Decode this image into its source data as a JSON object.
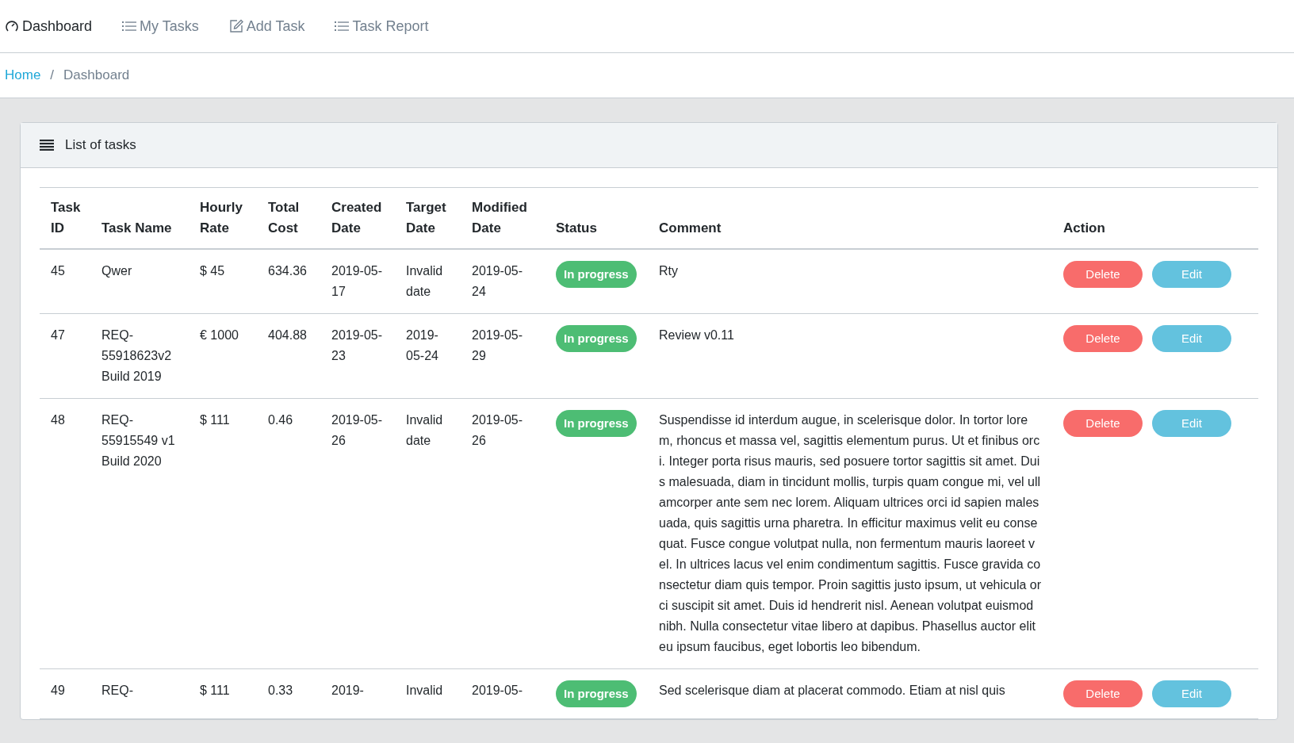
{
  "nav": [
    {
      "kind": "gauge",
      "label": "Dashboard",
      "selected": true
    },
    {
      "kind": "list",
      "label": "My Tasks",
      "selected": false
    },
    {
      "kind": "edit",
      "label": "Add Task",
      "selected": false
    },
    {
      "kind": "list",
      "label": "Task Report",
      "selected": false
    }
  ],
  "breadcrumb": [
    {
      "label": "Home",
      "kind": "link"
    },
    {
      "kind": "separator",
      "label": "/"
    },
    {
      "label": "Dashboard",
      "kind": "current"
    }
  ],
  "card": {
    "title": "List of tasks"
  },
  "table": {
    "columns": [
      "Task ID",
      "Task Name",
      "Hourly Rate",
      "Total Cost",
      "Created Date",
      "Target Date",
      "Modified Date",
      "Status",
      "Comment",
      "Action"
    ],
    "rows": [
      {
        "id": "45",
        "name": "Qwer",
        "rate": "$ 45",
        "cost": "634.36",
        "created": "2019-05-17",
        "target": "Invalid date",
        "modified": "2019-05-24",
        "status": {
          "label": "In progress",
          "kind": "progress"
        },
        "comment": "Rty",
        "actions": [
          {
            "label": "Delete",
            "kind": "danger"
          },
          {
            "label": "Edit",
            "kind": "info"
          }
        ]
      },
      {
        "id": "47",
        "name": "REQ-55918623v2 Build 2019",
        "rate": "€ 1000",
        "cost": "404.88",
        "created": "2019-05-23",
        "target": "2019-05-24",
        "modified": "2019-05-29",
        "status": {
          "label": "In progress",
          "kind": "progress"
        },
        "comment": "Review v0.11",
        "actions": [
          {
            "label": "Delete",
            "kind": "danger"
          },
          {
            "label": "Edit",
            "kind": "info"
          }
        ]
      },
      {
        "id": "48",
        "name": "REQ-55915549 v1 Build 2020",
        "rate": "$ 111",
        "cost": "0.46",
        "created": "2019-05-26",
        "target": "Invalid date",
        "modified": "2019-05-26",
        "status": {
          "label": "In progress",
          "kind": "progress"
        },
        "comment": "Suspendisse id interdum augue, in scelerisque dolor. In tortor lorem, rhoncus et massa vel, sagittis elementum purus. Ut et finibus orci. Integer porta risus mauris, sed posuere tortor sagittis sit amet. Duis malesuada, diam in tincidunt mollis, turpis quam congue mi, vel ullamcorper ante sem nec lorem. Aliquam ultrices orci id sapien malesuada, quis sagittis urna pharetra. In efficitur maximus velit eu consequat. Fusce congue volutpat nulla, non fermentum mauris laoreet vel. In ultrices lacus vel enim condimentum sagittis. Fusce gravida consectetur diam quis tempor. Proin sagittis justo ipsum, ut vehicula orci suscipit sit amet. Duis id hendrerit nisl. Aenean volutpat euismod nibh. Nulla consectetur vitae libero at dapibus. Phasellus auctor elit eu ipsum faucibus, eget lobortis leo bibendum.",
        "actions": [
          {
            "label": "Delete",
            "kind": "danger"
          },
          {
            "label": "Edit",
            "kind": "info"
          }
        ]
      },
      {
        "id": "49",
        "name": "REQ-",
        "rate": "$ 111",
        "cost": "0.33",
        "created": "2019-",
        "target": "Invalid",
        "modified": "2019-05-",
        "status": {
          "label": "In progress",
          "kind": "progress"
        },
        "comment": "Sed scelerisque diam at placerat commodo. Etiam at nisl quis",
        "actions": [
          {
            "label": "Delete",
            "kind": "danger"
          },
          {
            "label": "Edit",
            "kind": "info"
          }
        ]
      }
    ]
  }
}
